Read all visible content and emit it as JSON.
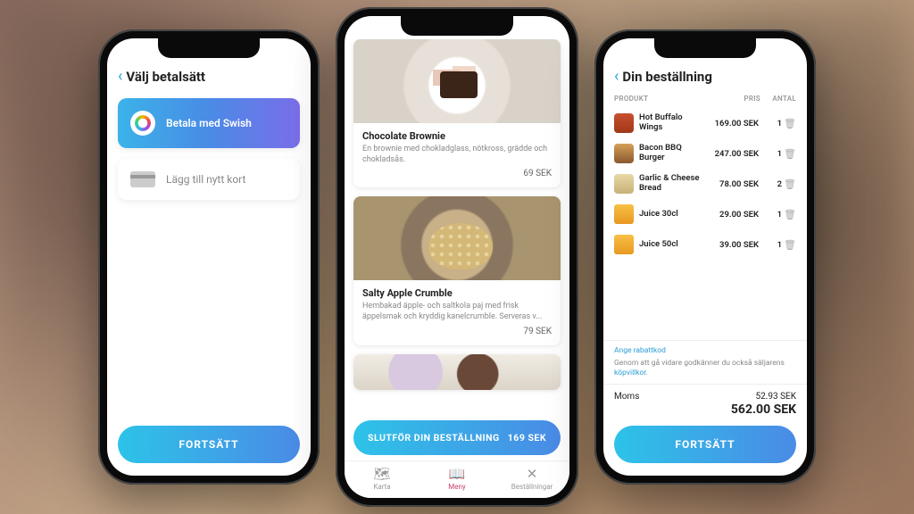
{
  "phone1": {
    "title": "Välj betalsätt",
    "swish_label": "Betala med Swish",
    "card_label": "Lägg till nytt kort",
    "continue": "FORTSÄTT"
  },
  "phone2": {
    "items": [
      {
        "title": "Chocolate Brownie",
        "desc": "En brownie med chokladglass, nötkross, grädde och chokladsås.",
        "price": "69 SEK"
      },
      {
        "title": "Salty Apple Crumble",
        "desc": "Hembakad äpple- och saltkola paj med frisk äppelsmak och kryddig kanelcrumble. Serveras v...",
        "price": "79 SEK"
      }
    ],
    "checkout_label": "SLUTFÖR DIN BESTÄLLNING",
    "checkout_price": "169 SEK",
    "tabs": [
      {
        "label": "Karta"
      },
      {
        "label": "Meny"
      },
      {
        "label": "Beställningar"
      }
    ]
  },
  "phone3": {
    "title": "Din beställning",
    "cols": {
      "product": "PRODUKT",
      "price": "PRIS",
      "qty": "ANTAL"
    },
    "items": [
      {
        "name": "Hot Buffalo Wings",
        "price": "169.00 SEK",
        "qty": "1",
        "thumb": "wings"
      },
      {
        "name": "Bacon BBQ Burger",
        "price": "247.00 SEK",
        "qty": "1",
        "thumb": "burger"
      },
      {
        "name": "Garlic & Cheese Bread",
        "price": "78.00 SEK",
        "qty": "2",
        "thumb": "bread"
      },
      {
        "name": "Juice 30cl",
        "price": "29.00 SEK",
        "qty": "1",
        "thumb": "juice"
      },
      {
        "name": "Juice 50cl",
        "price": "39.00 SEK",
        "qty": "1",
        "thumb": "juice"
      }
    ],
    "discount": "Ange rabattkod",
    "terms_pre": "Genom att gå vidare godkänner du också säljarens ",
    "terms_link": "köpvillkor",
    "vat_label": "Moms",
    "vat_value": "52.93 SEK",
    "total": "562.00 SEK",
    "continue": "FORTSÄTT"
  }
}
